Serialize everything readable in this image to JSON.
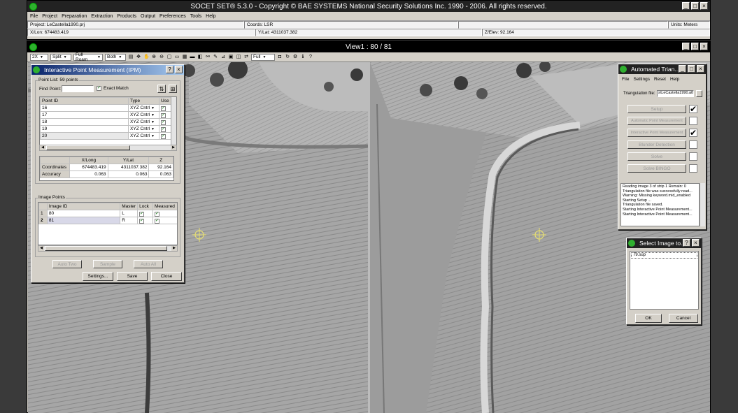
{
  "app": {
    "title": "SOCET SET® 5.3.0 - Copyright © BAE SYSTEMS National Security Solutions Inc. 1990 - 2006. All rights reserved.",
    "menu": [
      "File",
      "Project",
      "Preparation",
      "Extraction",
      "Products",
      "Output",
      "Preferences",
      "Tools",
      "Help"
    ],
    "project": "Project: LeCastella1990.prj",
    "coords": "Coords: LSR",
    "units": "Units: Meters",
    "xlon": "X/Lon: 674483.419",
    "ylat": "Y/Lat: 4311037.382",
    "zelev": "Z/Elev: 92.164"
  },
  "view": {
    "title": "View1 : 80 / 81",
    "toolbar": {
      "zoom": "2X",
      "split": "Split",
      "roam": "Full Roam",
      "both": "Both",
      "full": "Full"
    }
  },
  "ipm": {
    "title": "Interactive Point Measurement (IPM)",
    "point_list_label": "Point List: 59 points",
    "find_point_label": "Find Point:",
    "find_point_value": "",
    "exact_match_label": "Exact Match",
    "point_headers": [
      "Point ID",
      "Type",
      "Use"
    ],
    "points": [
      {
        "id": "16",
        "type": "XYZ Cntrl"
      },
      {
        "id": "17",
        "type": "XYZ Cntrl"
      },
      {
        "id": "18",
        "type": "XYZ Cntrl"
      },
      {
        "id": "19",
        "type": "XYZ Cntrl"
      },
      {
        "id": "20",
        "type": "XYZ Cntrl"
      }
    ],
    "coord_headers": [
      "X/Long",
      "Y/Lat",
      "Z"
    ],
    "coord_rows": [
      {
        "label": "Coordinates",
        "x": "674483.419",
        "y": "4311037.382",
        "z": "92.164"
      },
      {
        "label": "Accuracy",
        "x": "0.063",
        "y": "0.063",
        "z": "0.063"
      }
    ],
    "image_points_label": "Image Points",
    "image_headers": [
      "Image ID",
      "Master",
      "Lock",
      "Measured"
    ],
    "images": [
      {
        "num": "1",
        "id": "80",
        "master": "L"
      },
      {
        "num": "2",
        "id": "81",
        "master": "R"
      }
    ],
    "buttons": {
      "auto_two": "Auto Two",
      "sample": "Sample",
      "auto_all": "Auto All",
      "settings": "Settings...",
      "save": "Save",
      "close": "Close"
    }
  },
  "auto": {
    "title": "Automated Trian...",
    "menu": [
      "File",
      "Settings",
      "Reset",
      "Help"
    ],
    "tri_file_label": "Triangulation file:",
    "tri_file_value": "s\\LeCastella1990.atf",
    "steps": [
      {
        "label": "Setup",
        "checked": true
      },
      {
        "label": "Automatic Point Measurement",
        "checked": false
      },
      {
        "label": "Interactive Point Measurement",
        "checked": true
      },
      {
        "label": "Blunder Detection",
        "checked": false
      },
      {
        "label": "Solve",
        "checked": false
      },
      {
        "label": "Solve BINGO",
        "checked": false
      }
    ],
    "log": [
      "Reading image 3 of strip 1  Remain: 0",
      "Triangulation file was successfully read...",
      "Warning: Missing keyword.mid_enabled",
      "Starting Setup ...",
      "Triangulation file saved.",
      "Starting Interactive Point Measurement...",
      "Starting Interactive Point Measurement..."
    ]
  },
  "select": {
    "title": "Select Image to...",
    "item": "79.sup",
    "ok": "OK",
    "cancel": "Cancel"
  }
}
